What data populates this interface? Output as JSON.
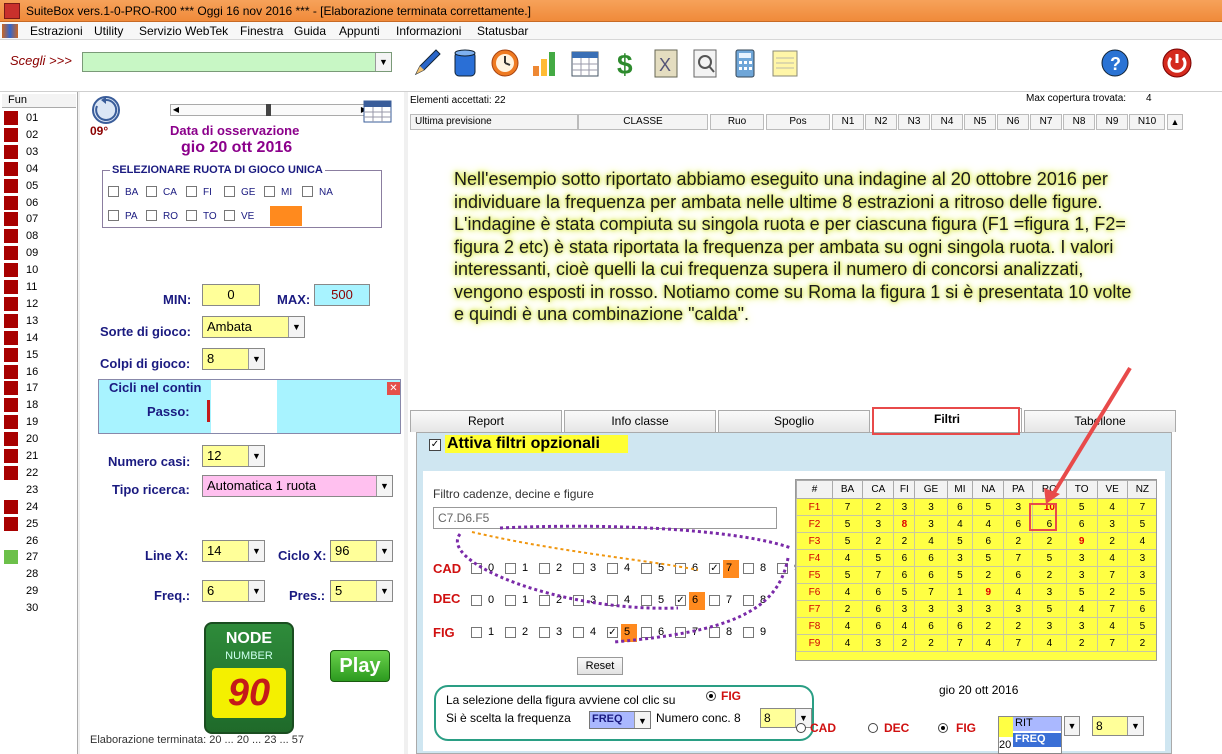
{
  "window": {
    "title": "SuiteBox vers.1-0-PRO-R00  ***  Oggi 16 nov 2016  ***   - [Elaborazione terminata correttamente.]"
  },
  "menu": [
    "Estrazioni",
    "Utility",
    "Servizio WebTek",
    "Finestra",
    "Guida",
    "Appunti",
    "Informazioni",
    "Statusbar"
  ],
  "toolbar": {
    "scegli_label": "Scegli >>>",
    "scegli_value": "",
    "icons": [
      "pencil-icon",
      "database-icon",
      "clock-icon",
      "bar-chart-icon",
      "calendar-grid-icon",
      "dollar-icon",
      "file-x-icon",
      "search-doc-icon",
      "calculator-icon",
      "notepad-icon",
      "help-icon",
      "power-icon"
    ]
  },
  "fun": {
    "header": "Fun",
    "rows": [
      {
        "label": "01",
        "state": "red"
      },
      {
        "label": "02",
        "state": "red"
      },
      {
        "label": "03",
        "state": "red"
      },
      {
        "label": "04",
        "state": "red"
      },
      {
        "label": "05",
        "state": "red"
      },
      {
        "label": "06",
        "state": "red"
      },
      {
        "label": "07",
        "state": "red"
      },
      {
        "label": "08",
        "state": "red"
      },
      {
        "label": "09",
        "state": "red"
      },
      {
        "label": "10",
        "state": "red"
      },
      {
        "label": "11",
        "state": "red"
      },
      {
        "label": "12",
        "state": "red"
      },
      {
        "label": "13",
        "state": "red"
      },
      {
        "label": "14",
        "state": "red"
      },
      {
        "label": "15",
        "state": "red"
      },
      {
        "label": "16",
        "state": "red"
      },
      {
        "label": "17",
        "state": "red"
      },
      {
        "label": "18",
        "state": "red"
      },
      {
        "label": "19",
        "state": "red"
      },
      {
        "label": "20",
        "state": "red"
      },
      {
        "label": "21",
        "state": "red"
      },
      {
        "label": "22",
        "state": "red"
      },
      {
        "label": "23",
        "state": "none"
      },
      {
        "label": "24",
        "state": "red"
      },
      {
        "label": "25",
        "state": "red"
      },
      {
        "label": "26",
        "state": "none"
      },
      {
        "label": "27",
        "state": "green"
      },
      {
        "label": "28",
        "state": "none"
      },
      {
        "label": "29",
        "state": "none"
      },
      {
        "label": "30",
        "state": "none"
      }
    ]
  },
  "params": {
    "angle": "09°",
    "date_title": "Data di osservazione",
    "date_value": "gio 20 ott 2016",
    "ruota_title": "SELEZIONARE RUOTA DI GIOCO UNICA",
    "ruote": [
      {
        "label": "BA",
        "checked": false
      },
      {
        "label": "CA",
        "checked": false
      },
      {
        "label": "FI",
        "checked": false
      },
      {
        "label": "GE",
        "checked": false
      },
      {
        "label": "MI",
        "checked": false
      },
      {
        "label": "NA",
        "checked": false
      },
      {
        "label": "PA",
        "checked": false
      },
      {
        "label": "RO",
        "checked": false
      },
      {
        "label": "TO",
        "checked": false
      },
      {
        "label": "VE",
        "checked": false
      },
      {
        "label": "NZ",
        "checked": true
      }
    ],
    "min_label": "MIN:",
    "min_value": "0",
    "max_label": "MAX:",
    "max_value": "500",
    "sorte_label": "Sorte di gioco:",
    "sorte_value": "Ambata",
    "colpi_label": "Colpi di gioco:",
    "colpi_value": "8",
    "cicli_title": "Cicli nel contin",
    "passo_label": "Passo:",
    "casi_label": "Numero casi:",
    "casi_value": "12",
    "tipo_label": "Tipo ricerca:",
    "tipo_value": "Automatica 1 ruota",
    "linex_label": "Line X:",
    "linex_value": "14",
    "ciclox_label": "Ciclo X:",
    "ciclox_value": "96",
    "freq_label": "Freq.:",
    "freq_value": "6",
    "pres_label": "Pres.:",
    "pres_value": "5",
    "logo_top": "NODE",
    "logo_mid": "NUMBER",
    "logo_num": "90",
    "play_label": "Play",
    "status_line": "Elaborazione terminata: 20 ... 20 ... 23 ... 57"
  },
  "right": {
    "accepted": "Elementi accettati: 22",
    "max_cov_label": "Max copertura trovata:",
    "max_cov_value": "4",
    "columns": [
      "Ultima previsione",
      "CLASSE",
      "Ruo",
      "Pos",
      "N1",
      "N2",
      "N3",
      "N4",
      "N5",
      "N6",
      "N7",
      "N8",
      "N9",
      "N10"
    ],
    "annotation": "Nell'esempio sotto riportato abbiamo eseguito una indagine al 20 ottobre 2016 per individuare la frequenza per ambata nelle ultime 8 estrazioni a ritroso delle figure. L'indagine è stata compiuta su singola ruota e per ciascuna figura  (F1 =figura 1, F2= figura 2 etc) è stata riportata la frequenza per ambata su ogni singola ruota. I valori interessanti, cioè quelli la cui frequenza supera il numero di concorsi analizzati, vengono esposti in rosso. Notiamo come su Roma la figura 1 si è presentata 10 volte e quindi è una combinazione \"calda\".",
    "tabs": [
      "Report",
      "Info classe",
      "Spoglio",
      "Filtri",
      "Tabellone"
    ],
    "active_tab": "Filtri",
    "filters_toggle": "Attiva filtri opzionali",
    "filter_title": "Filtro cadenze, decine e figure",
    "filter_value": "C7.D6.F5",
    "cad_label": "CAD",
    "dec_label": "DEC",
    "fig_label": "FIG",
    "cad_digits": [
      "0",
      "1",
      "2",
      "3",
      "4",
      "5",
      "6",
      "7",
      "8",
      "9"
    ],
    "dec_digits": [
      "0",
      "1",
      "2",
      "3",
      "4",
      "5",
      "6",
      "7",
      "8"
    ],
    "fig_digits": [
      "1",
      "2",
      "3",
      "4",
      "5",
      "6",
      "7",
      "8",
      "9"
    ],
    "cad_checked": "7",
    "dec_checked": "6",
    "fig_checked": "5",
    "reset_label": "Reset",
    "note_line1": "La selezione della figura avviene col clic su",
    "note_fig": "FIG",
    "note_line2": "Si è scelta la frequenza",
    "freq_value": "FREQ",
    "conc_label": "Numero conc. 8",
    "conc_value": "8",
    "grid_date": "gio 20 ott 2016",
    "bottom_cad": "CAD",
    "bottom_dec": "DEC",
    "bottom_fig": "FIG",
    "list_items": [
      "RIT",
      "FREQ"
    ],
    "list_prefix": "20",
    "bottom_num": "8",
    "grid_headers": [
      "#",
      "BA",
      "CA",
      "FI",
      "GE",
      "MI",
      "NA",
      "PA",
      "RO",
      "TO",
      "VE",
      "NZ"
    ],
    "grid_rows": [
      {
        "label": "F1",
        "values": [
          "7",
          "2",
          "3",
          "3",
          "6",
          "5",
          "3",
          "10",
          "5",
          "4",
          "7"
        ],
        "red": [
          7
        ]
      },
      {
        "label": "F2",
        "values": [
          "5",
          "3",
          "8",
          "3",
          "4",
          "4",
          "6",
          "6",
          "6",
          "3",
          "5"
        ],
        "red": [
          2
        ]
      },
      {
        "label": "F3",
        "values": [
          "5",
          "2",
          "2",
          "4",
          "5",
          "6",
          "2",
          "2",
          "9",
          "2",
          "4"
        ],
        "red": [
          8
        ]
      },
      {
        "label": "F4",
        "values": [
          "4",
          "5",
          "6",
          "6",
          "3",
          "5",
          "7",
          "5",
          "3",
          "4",
          "3"
        ],
        "red": []
      },
      {
        "label": "F5",
        "values": [
          "5",
          "7",
          "6",
          "6",
          "5",
          "2",
          "6",
          "2",
          "3",
          "7",
          "3"
        ],
        "red": []
      },
      {
        "label": "F6",
        "values": [
          "4",
          "6",
          "5",
          "7",
          "1",
          "9",
          "4",
          "3",
          "5",
          "2",
          "5"
        ],
        "red": [
          5
        ]
      },
      {
        "label": "F7",
        "values": [
          "2",
          "6",
          "3",
          "3",
          "3",
          "3",
          "3",
          "5",
          "4",
          "7",
          "6"
        ],
        "red": []
      },
      {
        "label": "F8",
        "values": [
          "4",
          "6",
          "4",
          "6",
          "6",
          "2",
          "2",
          "3",
          "3",
          "4",
          "5"
        ],
        "red": []
      },
      {
        "label": "F9",
        "values": [
          "4",
          "3",
          "2",
          "2",
          "7",
          "4",
          "7",
          "4",
          "2",
          "7",
          "2"
        ],
        "red": []
      }
    ]
  }
}
